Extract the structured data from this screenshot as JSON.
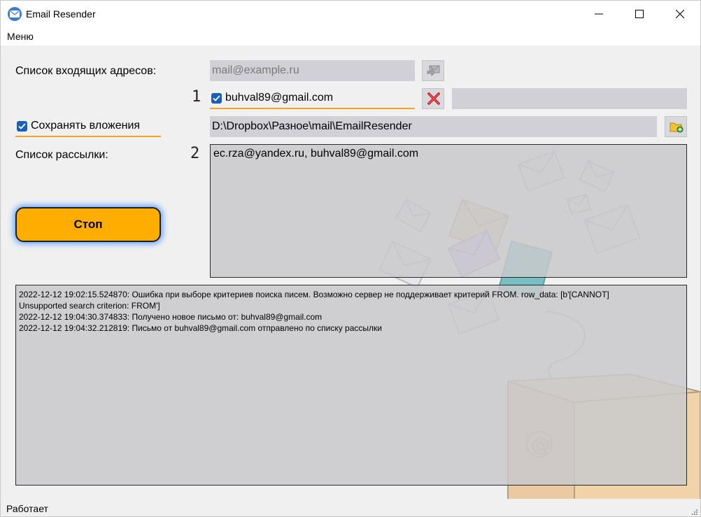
{
  "window": {
    "title": "Email Resender"
  },
  "menu": {
    "items": [
      {
        "label": "Меню"
      }
    ]
  },
  "inbox": {
    "label": "Список входящих адресов:",
    "placeholder": "mail@example.ru",
    "counter": "1",
    "entry": {
      "email": "buhval89@gmail.com",
      "checked": true
    }
  },
  "attachments": {
    "checkbox_label": "Сохранять вложения",
    "checked": true,
    "path": "D:\\Dropbox\\Разное\\mail\\EmailResender"
  },
  "mailing": {
    "label": "Список рассылки:",
    "counter": "2",
    "recipients": "ec.rza@yandex.ru, buhval89@gmail.com"
  },
  "stop_button": {
    "label": "Стоп"
  },
  "log": {
    "lines": [
      "2022-12-12 19:02:15.524870: Ошибка при выборе критериев поиска писем. Возможно сервер не поддерживает критерий FROM. row_data: [b'[CANNOT]",
      "Unsupported search criterion: FROM']",
      "2022-12-12 19:04:30.374833: Получено новое письмо от: buhval89@gmail.com",
      "2022-12-12 19:04:32.212819: Письмо от buhval89@gmail.com отправлено по списку рассылки"
    ]
  },
  "status": {
    "text": "Работает"
  },
  "colors": {
    "accent_orange": "#ffad00",
    "underline_orange": "#f2a21b",
    "checkbox_blue": "#1a5fb4",
    "field_bg": "#d0d0d6"
  },
  "icons": [
    "envelope-app-icon",
    "minimize-icon",
    "maximize-icon",
    "close-icon",
    "add-envelope-icon",
    "delete-x-icon",
    "folder-add-icon",
    "check-icon",
    "resize-grip-icon"
  ]
}
